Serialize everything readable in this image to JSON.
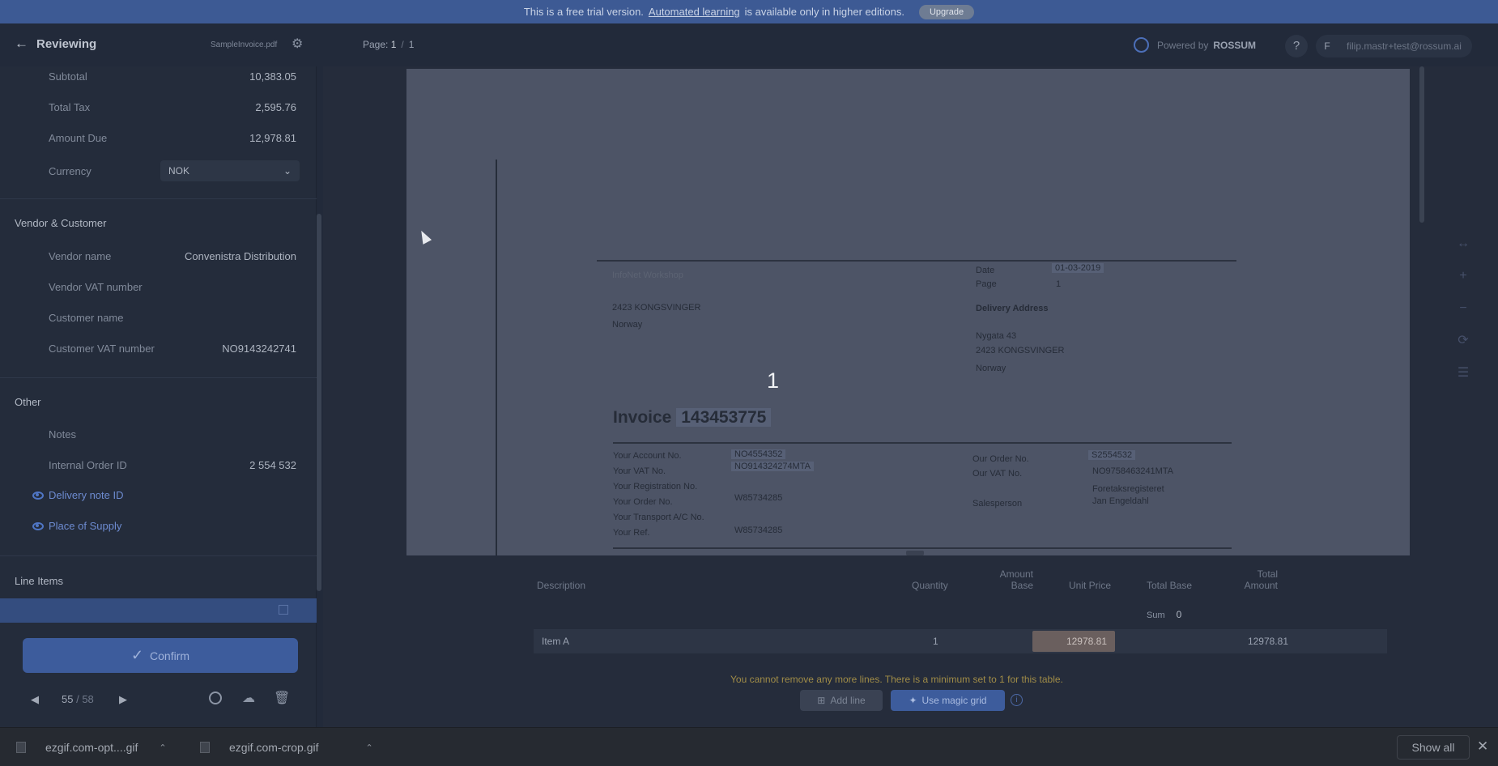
{
  "banner": {
    "text_before": "This is a free trial version.",
    "link": "Automated learning",
    "text_after": "is available only in higher editions.",
    "upgrade": "Upgrade"
  },
  "header": {
    "back_label": "Reviewing",
    "filename": "SampleInvoice.pdf",
    "page_label": "Page:",
    "page_current": "1",
    "page_sep": "/",
    "page_total": "1",
    "powered_by": "Powered by",
    "brand": "ROSSUM",
    "help": "?",
    "user_initial": "F",
    "user_email": "filip.mastr+test@rossum.ai"
  },
  "fields": {
    "subtotal": {
      "label": "Subtotal",
      "value": "10,383.05"
    },
    "total_tax": {
      "label": "Total Tax",
      "value": "2,595.76"
    },
    "amount_due": {
      "label": "Amount Due",
      "value": "12,978.81"
    },
    "currency": {
      "label": "Currency",
      "value": "NOK"
    }
  },
  "vendor_section": {
    "title": "Vendor & Customer",
    "vendor_name": {
      "label": "Vendor name",
      "value": "Convenistra Distribution"
    },
    "vendor_vat": {
      "label": "Vendor VAT number",
      "value": ""
    },
    "customer_name": {
      "label": "Customer name",
      "value": ""
    },
    "customer_vat": {
      "label": "Customer VAT number",
      "value": "NO9143242741"
    }
  },
  "other_section": {
    "title": "Other",
    "notes": {
      "label": "Notes",
      "value": ""
    },
    "internal_order": {
      "label": "Internal Order ID",
      "value": "2 554 532"
    },
    "delivery_note": {
      "label": "Delivery note ID"
    },
    "place_of_supply": {
      "label": "Place of Supply"
    }
  },
  "line_items_section": {
    "title": "Line Items"
  },
  "confirm": {
    "label": "Confirm"
  },
  "pager": {
    "current": "55",
    "sep": " / ",
    "total": "58"
  },
  "document": {
    "company": "InfoNet Workshop",
    "address1": "2423 KONGSVINGER",
    "country": "Norway",
    "date_label": "Date",
    "date_value": "01-03-2019",
    "page_label": "Page",
    "page_value": "1",
    "delivery_label": "Delivery Address",
    "street": "Nygata 43",
    "delivery_city": "2423 KONGSVINGER",
    "delivery_country": "Norway",
    "invoice_label": "Invoice",
    "invoice_number": "143453775",
    "marker": "1",
    "rows_left": [
      {
        "label": "Your Account No.",
        "value": "NO4554352"
      },
      {
        "label": "Your VAT No.",
        "value": "NO914324274MTA"
      },
      {
        "label": "Your Registration No.",
        "value": ""
      },
      {
        "label": "Your Order No.",
        "value": "W85734285"
      },
      {
        "label": "Your Transport A/C No.",
        "value": ""
      },
      {
        "label": "Your Ref.",
        "value": "W85734285"
      }
    ],
    "rows_right": [
      {
        "label": "Our Order No.",
        "value": "S2554532"
      },
      {
        "label": "Our VAT No.",
        "value": "NO9758463241MTA"
      },
      {
        "label": "",
        "value": "Foretaksregisteret"
      },
      {
        "label": "Salesperson",
        "value": "Jan Engeldahl"
      }
    ]
  },
  "table": {
    "headers": {
      "description": "Description",
      "quantity": "Quantity",
      "amount_base_1": "Amount",
      "amount_base_2": "Base",
      "unit_price": "Unit Price",
      "total_base": "Total Base",
      "total_amount_1": "Total",
      "total_amount_2": "Amount"
    },
    "sum_label": "Sum",
    "sum_value": "0",
    "rows": [
      {
        "description": "Item A",
        "quantity": "1",
        "unit_price": "12978.81",
        "total_amount": "12978.81"
      }
    ],
    "warning": "You cannot remove any more lines. There is a minimum set to 1 for this table.",
    "add_line": "Add line",
    "magic_grid": "Use magic grid"
  },
  "downloads": {
    "file1": "ezgif.com-opt....gif",
    "file2": "ezgif.com-crop.gif",
    "show_all": "Show all"
  },
  "colors": {
    "accent": "#3d5c9c",
    "banner": "#3d5a94",
    "warning": "#a08c47"
  }
}
